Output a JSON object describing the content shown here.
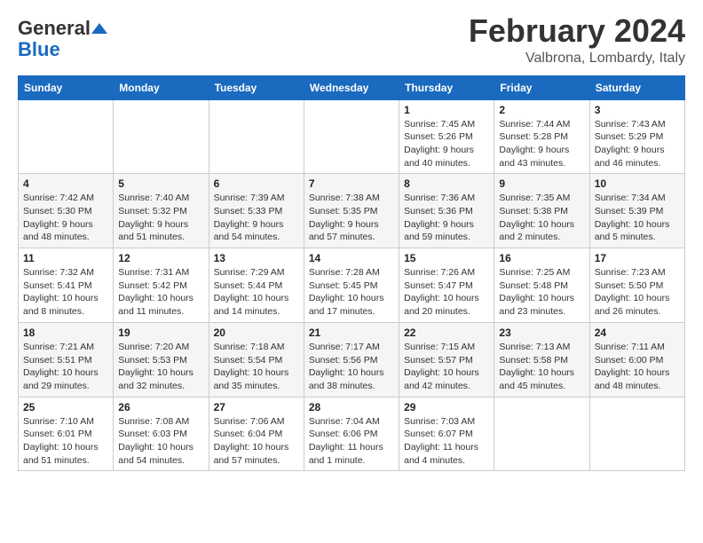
{
  "header": {
    "logo_line1": "General",
    "logo_line2": "Blue",
    "month": "February 2024",
    "location": "Valbrona, Lombardy, Italy"
  },
  "weekdays": [
    "Sunday",
    "Monday",
    "Tuesday",
    "Wednesday",
    "Thursday",
    "Friday",
    "Saturday"
  ],
  "rows": [
    [
      {
        "day": "",
        "info": ""
      },
      {
        "day": "",
        "info": ""
      },
      {
        "day": "",
        "info": ""
      },
      {
        "day": "",
        "info": ""
      },
      {
        "day": "1",
        "info": "Sunrise: 7:45 AM\nSunset: 5:26 PM\nDaylight: 9 hours\nand 40 minutes."
      },
      {
        "day": "2",
        "info": "Sunrise: 7:44 AM\nSunset: 5:28 PM\nDaylight: 9 hours\nand 43 minutes."
      },
      {
        "day": "3",
        "info": "Sunrise: 7:43 AM\nSunset: 5:29 PM\nDaylight: 9 hours\nand 46 minutes."
      }
    ],
    [
      {
        "day": "4",
        "info": "Sunrise: 7:42 AM\nSunset: 5:30 PM\nDaylight: 9 hours\nand 48 minutes."
      },
      {
        "day": "5",
        "info": "Sunrise: 7:40 AM\nSunset: 5:32 PM\nDaylight: 9 hours\nand 51 minutes."
      },
      {
        "day": "6",
        "info": "Sunrise: 7:39 AM\nSunset: 5:33 PM\nDaylight: 9 hours\nand 54 minutes."
      },
      {
        "day": "7",
        "info": "Sunrise: 7:38 AM\nSunset: 5:35 PM\nDaylight: 9 hours\nand 57 minutes."
      },
      {
        "day": "8",
        "info": "Sunrise: 7:36 AM\nSunset: 5:36 PM\nDaylight: 9 hours\nand 59 minutes."
      },
      {
        "day": "9",
        "info": "Sunrise: 7:35 AM\nSunset: 5:38 PM\nDaylight: 10 hours\nand 2 minutes."
      },
      {
        "day": "10",
        "info": "Sunrise: 7:34 AM\nSunset: 5:39 PM\nDaylight: 10 hours\nand 5 minutes."
      }
    ],
    [
      {
        "day": "11",
        "info": "Sunrise: 7:32 AM\nSunset: 5:41 PM\nDaylight: 10 hours\nand 8 minutes."
      },
      {
        "day": "12",
        "info": "Sunrise: 7:31 AM\nSunset: 5:42 PM\nDaylight: 10 hours\nand 11 minutes."
      },
      {
        "day": "13",
        "info": "Sunrise: 7:29 AM\nSunset: 5:44 PM\nDaylight: 10 hours\nand 14 minutes."
      },
      {
        "day": "14",
        "info": "Sunrise: 7:28 AM\nSunset: 5:45 PM\nDaylight: 10 hours\nand 17 minutes."
      },
      {
        "day": "15",
        "info": "Sunrise: 7:26 AM\nSunset: 5:47 PM\nDaylight: 10 hours\nand 20 minutes."
      },
      {
        "day": "16",
        "info": "Sunrise: 7:25 AM\nSunset: 5:48 PM\nDaylight: 10 hours\nand 23 minutes."
      },
      {
        "day": "17",
        "info": "Sunrise: 7:23 AM\nSunset: 5:50 PM\nDaylight: 10 hours\nand 26 minutes."
      }
    ],
    [
      {
        "day": "18",
        "info": "Sunrise: 7:21 AM\nSunset: 5:51 PM\nDaylight: 10 hours\nand 29 minutes."
      },
      {
        "day": "19",
        "info": "Sunrise: 7:20 AM\nSunset: 5:53 PM\nDaylight: 10 hours\nand 32 minutes."
      },
      {
        "day": "20",
        "info": "Sunrise: 7:18 AM\nSunset: 5:54 PM\nDaylight: 10 hours\nand 35 minutes."
      },
      {
        "day": "21",
        "info": "Sunrise: 7:17 AM\nSunset: 5:56 PM\nDaylight: 10 hours\nand 38 minutes."
      },
      {
        "day": "22",
        "info": "Sunrise: 7:15 AM\nSunset: 5:57 PM\nDaylight: 10 hours\nand 42 minutes."
      },
      {
        "day": "23",
        "info": "Sunrise: 7:13 AM\nSunset: 5:58 PM\nDaylight: 10 hours\nand 45 minutes."
      },
      {
        "day": "24",
        "info": "Sunrise: 7:11 AM\nSunset: 6:00 PM\nDaylight: 10 hours\nand 48 minutes."
      }
    ],
    [
      {
        "day": "25",
        "info": "Sunrise: 7:10 AM\nSunset: 6:01 PM\nDaylight: 10 hours\nand 51 minutes."
      },
      {
        "day": "26",
        "info": "Sunrise: 7:08 AM\nSunset: 6:03 PM\nDaylight: 10 hours\nand 54 minutes."
      },
      {
        "day": "27",
        "info": "Sunrise: 7:06 AM\nSunset: 6:04 PM\nDaylight: 10 hours\nand 57 minutes."
      },
      {
        "day": "28",
        "info": "Sunrise: 7:04 AM\nSunset: 6:06 PM\nDaylight: 11 hours\nand 1 minute."
      },
      {
        "day": "29",
        "info": "Sunrise: 7:03 AM\nSunset: 6:07 PM\nDaylight: 11 hours\nand 4 minutes."
      },
      {
        "day": "",
        "info": ""
      },
      {
        "day": "",
        "info": ""
      }
    ]
  ]
}
